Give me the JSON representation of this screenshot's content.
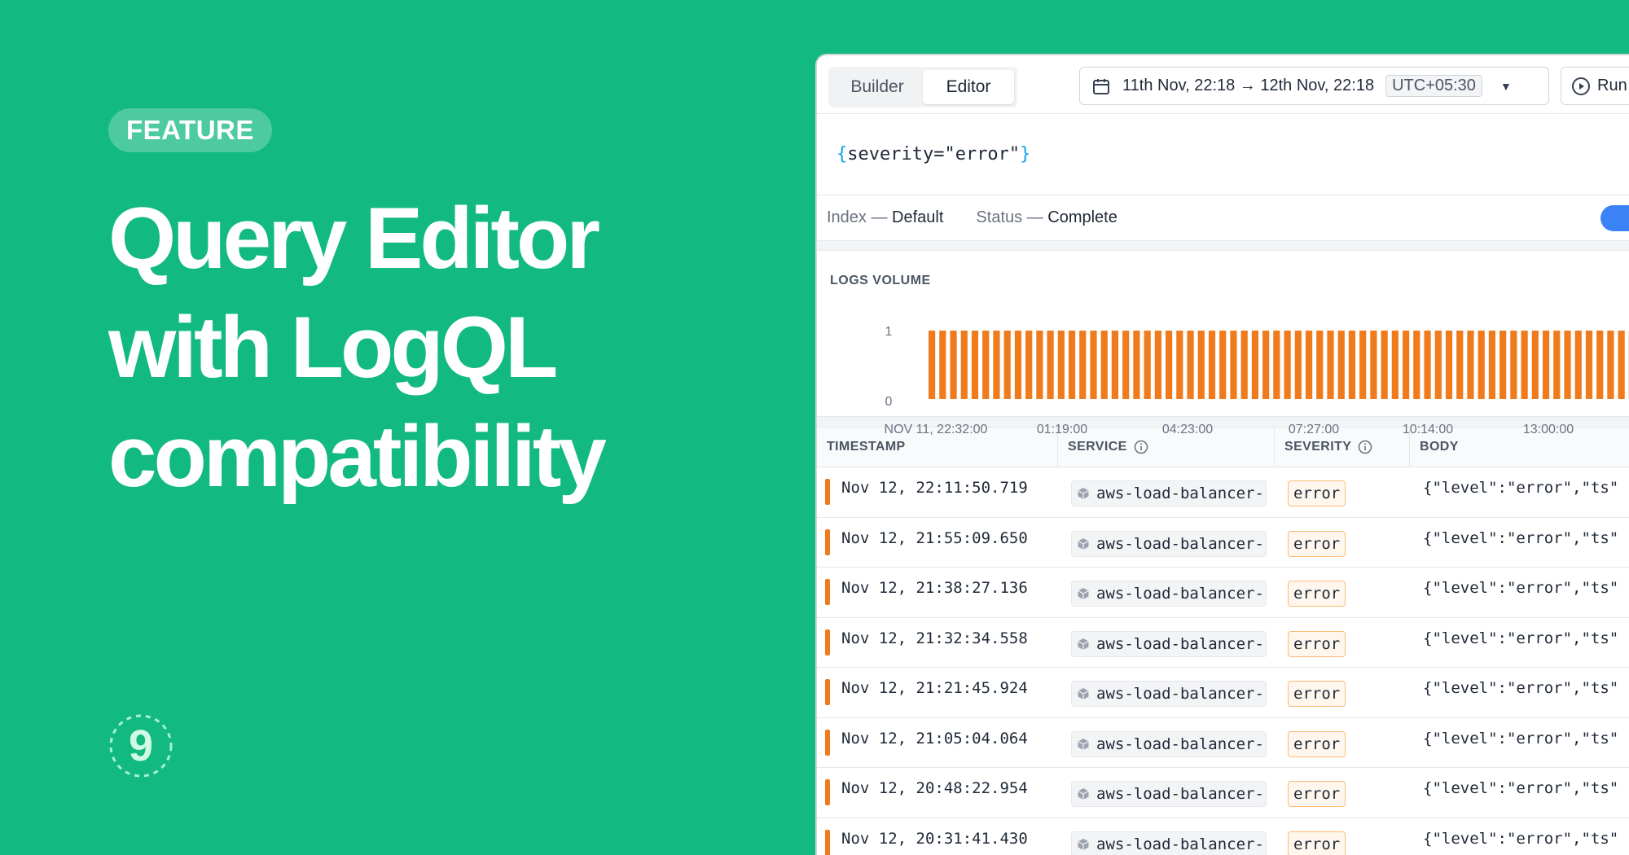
{
  "hero": {
    "badge": "FEATURE",
    "title_lines": [
      "Query Editor",
      "with LogQL",
      "compatibility"
    ],
    "logo_glyph": "9"
  },
  "toolbar": {
    "tabs": [
      {
        "label": "Builder",
        "active": false
      },
      {
        "label": "Editor",
        "active": true
      }
    ],
    "time_range": "11th Nov, 22:18 → 12th Nov, 22:18",
    "timezone": "UTC+05:30",
    "run_label": "Run"
  },
  "query": {
    "open": "{",
    "text": "severity=\"error\"",
    "close": "}"
  },
  "status": {
    "index_label": "Index —",
    "index_value": "Default",
    "status_label": "Status —",
    "status_value": "Complete"
  },
  "logs_volume": {
    "title": "LOGS VOLUME"
  },
  "chart_data": {
    "type": "bar",
    "title": "LOGS VOLUME",
    "yticks": [
      "1",
      "0"
    ],
    "xticks": [
      "NOV 11, 22:32:00",
      "01:19:00",
      "04:23:00",
      "07:27:00",
      "10:14:00",
      "13:00:00"
    ],
    "ylim": [
      0,
      1
    ],
    "bar_count": 66,
    "values": [
      1,
      1,
      1,
      1,
      1,
      1,
      1,
      1,
      1,
      1,
      1,
      1,
      1,
      1,
      1,
      1,
      1,
      1,
      1,
      1,
      1,
      1,
      1,
      1,
      1,
      1,
      1,
      1,
      1,
      1,
      1,
      1,
      1,
      1,
      1,
      1,
      1,
      1,
      1,
      1,
      1,
      1,
      1,
      1,
      1,
      1,
      1,
      1,
      1,
      1,
      1,
      1,
      1,
      1,
      1,
      1,
      1,
      1,
      1,
      1,
      1,
      1,
      1,
      1,
      1,
      1
    ],
    "bar_color": "#f07b1d",
    "grid": false
  },
  "table": {
    "columns": [
      "TIMESTAMP",
      "SERVICE",
      "SEVERITY",
      "BODY"
    ],
    "rows": [
      {
        "timestamp": "Nov 12, 22:11:50.719",
        "service": "aws-load-balancer-",
        "severity": "error",
        "body": "{\"level\":\"error\",\"ts\""
      },
      {
        "timestamp": "Nov 12, 21:55:09.650",
        "service": "aws-load-balancer-",
        "severity": "error",
        "body": "{\"level\":\"error\",\"ts\""
      },
      {
        "timestamp": "Nov 12, 21:38:27.136",
        "service": "aws-load-balancer-",
        "severity": "error",
        "body": "{\"level\":\"error\",\"ts\""
      },
      {
        "timestamp": "Nov 12, 21:32:34.558",
        "service": "aws-load-balancer-",
        "severity": "error",
        "body": "{\"level\":\"error\",\"ts\""
      },
      {
        "timestamp": "Nov 12, 21:21:45.924",
        "service": "aws-load-balancer-",
        "severity": "error",
        "body": "{\"level\":\"error\",\"ts\""
      },
      {
        "timestamp": "Nov 12, 21:05:04.064",
        "service": "aws-load-balancer-",
        "severity": "error",
        "body": "{\"level\":\"error\",\"ts\""
      },
      {
        "timestamp": "Nov 12, 20:48:22.954",
        "service": "aws-load-balancer-",
        "severity": "error",
        "body": "{\"level\":\"error\",\"ts\""
      },
      {
        "timestamp": "Nov 12, 20:31:41.430",
        "service": "aws-load-balancer-",
        "severity": "error",
        "body": "{\"level\":\"error\",\"ts\""
      }
    ]
  },
  "colors": {
    "background": "#12b981",
    "accent_bar": "#f07b1d",
    "toggle": "#3b82f6",
    "brace": "#0ea5e9"
  }
}
